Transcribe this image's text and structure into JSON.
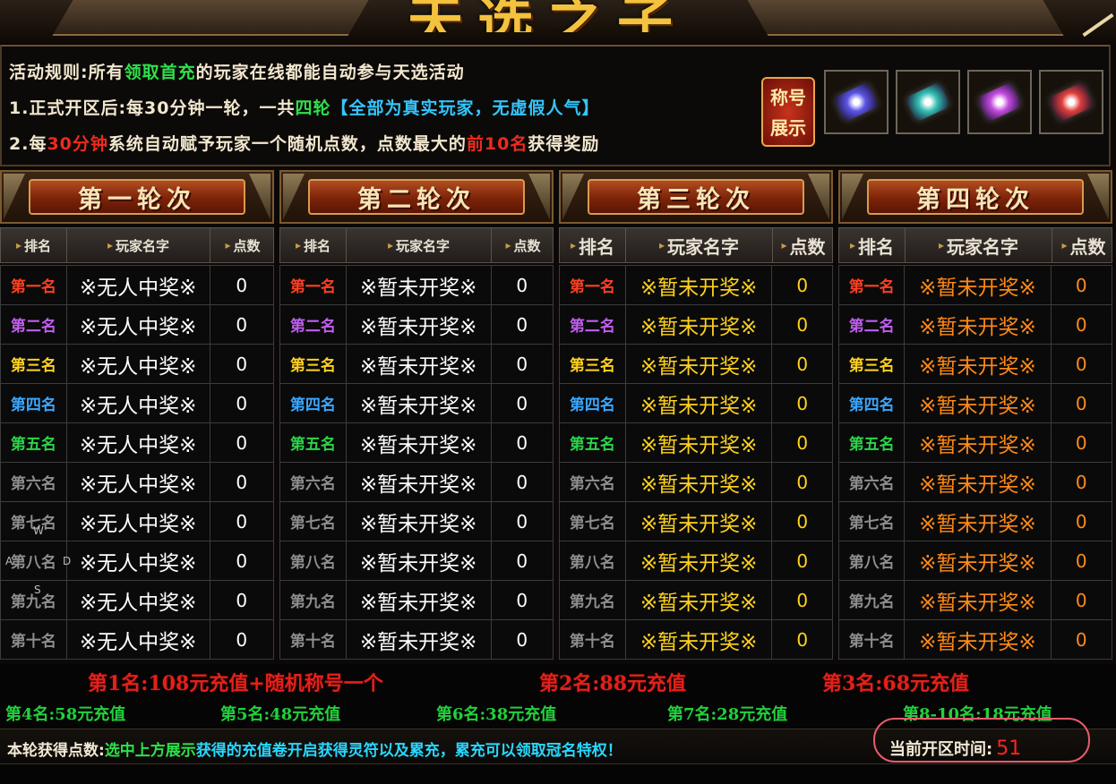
{
  "banner": {
    "title_fragment": "天选之子"
  },
  "rules": {
    "line1": {
      "prefix": "活动规则:所有",
      "highlight": "领取首充",
      "suffix": "的玩家在线都能自动参与天选活动"
    },
    "line2": {
      "prefix": "1.正式开区后:每30分钟一轮，一共",
      "highlight": "四轮",
      "bracket": "【全部为真实玩家，无虚假人气】"
    },
    "line3": {
      "prefix": "2.每",
      "highlight1": "30分钟",
      "middle": "系统自动赋予玩家一个随机点数，点数最大的",
      "highlight2": "前10名",
      "suffix": "获得奖励"
    },
    "badge": {
      "line1": "称号",
      "line2": "展示"
    },
    "scroll_icons": [
      "scroll-blue-icon",
      "scroll-teal-icon",
      "scroll-purple-icon",
      "scroll-red-icon"
    ],
    "scroll_colors": [
      "#5b55e6",
      "#35c0b6",
      "#c44be0",
      "#e0403c"
    ]
  },
  "columns": {
    "rank": "排名",
    "name": "玩家名字",
    "points": "点数"
  },
  "rank_labels": [
    "第一名",
    "第二名",
    "第三名",
    "第四名",
    "第五名",
    "第六名",
    "第七名",
    "第八名",
    "第九名",
    "第十名"
  ],
  "rank_colors": [
    "#ff3f22",
    "#c05ef0",
    "#ffd21e",
    "#3aa7ff",
    "#2cd44a",
    "#8e8e8e",
    "#8e8e8e",
    "#8e8e8e",
    "#8e8e8e",
    "#8e8e8e"
  ],
  "rounds": [
    {
      "title": "第一轮次",
      "name_color": "#ffffff",
      "point_color": "#ffffff",
      "players": [
        "※无人中奖※",
        "※无人中奖※",
        "※无人中奖※",
        "※无人中奖※",
        "※无人中奖※",
        "※无人中奖※",
        "※无人中奖※",
        "※无人中奖※",
        "※无人中奖※",
        "※无人中奖※"
      ],
      "points": [
        "0",
        "0",
        "0",
        "0",
        "0",
        "0",
        "0",
        "0",
        "0",
        "0"
      ]
    },
    {
      "title": "第二轮次",
      "name_color": "#ffffff",
      "point_color": "#ffffff",
      "players": [
        "※暂未开奖※",
        "※暂未开奖※",
        "※暂未开奖※",
        "※暂未开奖※",
        "※暂未开奖※",
        "※暂未开奖※",
        "※暂未开奖※",
        "※暂未开奖※",
        "※暂未开奖※",
        "※暂未开奖※"
      ],
      "points": [
        "0",
        "0",
        "0",
        "0",
        "0",
        "0",
        "0",
        "0",
        "0",
        "0"
      ]
    },
    {
      "title": "第三轮次",
      "name_color": "#ffd21e",
      "point_color": "#ffd21e",
      "players": [
        "※暂未开奖※",
        "※暂未开奖※",
        "※暂未开奖※",
        "※暂未开奖※",
        "※暂未开奖※",
        "※暂未开奖※",
        "※暂未开奖※",
        "※暂未开奖※",
        "※暂未开奖※",
        "※暂未开奖※"
      ],
      "points": [
        "0",
        "0",
        "0",
        "0",
        "0",
        "0",
        "0",
        "0",
        "0",
        "0"
      ]
    },
    {
      "title": "第四轮次",
      "name_color": "#ff8a18",
      "point_color": "#ff8a18",
      "players": [
        "※暂未开奖※",
        "※暂未开奖※",
        "※暂未开奖※",
        "※暂未开奖※",
        "※暂未开奖※",
        "※暂未开奖※",
        "※暂未开奖※",
        "※暂未开奖※",
        "※暂未开奖※",
        "※暂未开奖※"
      ],
      "points": [
        "0",
        "0",
        "0",
        "0",
        "0",
        "0",
        "0",
        "0",
        "0",
        "0"
      ]
    }
  ],
  "rewards": {
    "first": "第1名:108元充值+随机称号一个",
    "second": "第2名:88元充值",
    "third": "第3名:68元充值",
    "fourth": "第4名:58元充值",
    "fifth": "第5名:48元充值",
    "sixth": "第6名:38元充值",
    "seventh": "第7名:28元充值",
    "eighth_tenth": "第8-10名:18元充值"
  },
  "notice": {
    "label": "本轮获得点数:",
    "highlight": "选中上方展示",
    "text": "获得的充值卷开启获得灵符以及累充，累充可以领取冠名特权！"
  },
  "open_time": {
    "label": "当前开区时间:",
    "value": "51"
  },
  "overlay_keys": [
    "W",
    "A",
    "D",
    "S"
  ]
}
